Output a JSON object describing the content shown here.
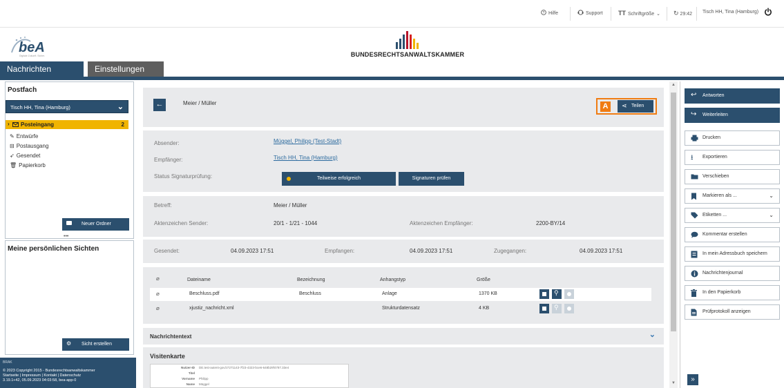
{
  "topbar": {
    "help": "Hilfe",
    "support": "Support",
    "font_size": "Schriftgröße",
    "timer": "29:42",
    "user": "Tisch HH, Tina (Hamburg)"
  },
  "logo_text": "beA",
  "logo_subtext": "Digitale Zukunft. Sicher.",
  "brand": "BUNDESRECHTSANWALTSKAMMER",
  "nav": {
    "messages": "Nachrichten",
    "settings": "Einstellungen"
  },
  "sidebar": {
    "title": "Postfach",
    "mailbox": "Tisch HH, Tina (Hamburg)",
    "folders": [
      {
        "label": "Posteingang",
        "count": "2"
      },
      {
        "label": "Entwürfe"
      },
      {
        "label": "Postausgang"
      },
      {
        "label": "Gesendet"
      },
      {
        "label": "Papierkorb"
      }
    ],
    "new_folder": "Neuer Ordner",
    "views_title": "Meine persönlichen Sichten",
    "create_view": "Sicht erstellen",
    "footer": [
      "© 2023 Copyright 2015 - Bundesrechtsanwaltskammer",
      "Startseite | Impressum | Kontakt | Datenschutz",
      "3.19.1+42, 05.09.2023 04:03:58, bea-app-0"
    ],
    "footer_logo": "BRAK"
  },
  "message": {
    "subject_header": "Meier / Müller",
    "share_badge": "A",
    "share": "Teilen",
    "sender_label": "Absender:",
    "sender": "Müggel, Philipp (Test-Stadt)",
    "recipient_label": "Empfänger:",
    "recipient": "Tisch HH, Tina (Hamburg)",
    "sig_label": "Status Signaturprüfung:",
    "sig_status": "Teilweise erfolgreich",
    "sig_check": "Signaturen prüfen",
    "subject_label": "Betreff:",
    "subject": "Meier / Müller",
    "ref_sender_label": "Aktenzeichen Sender:",
    "ref_sender": "20/1 - 1/21 - 1044",
    "ref_recipient_label": "Aktenzeichen Empfänger:",
    "ref_recipient": "2200-BY/14",
    "sent_label": "Gesendet:",
    "sent": "04.09.2023 17:51",
    "received_label": "Empfangen:",
    "received": "04.09.2023 17:51",
    "delivered_label": "Zugegangen:",
    "delivered": "04.09.2023 17:51"
  },
  "attachments": {
    "headers": [
      "Dateiname",
      "Bezeichnung",
      "Anhangstyp",
      "Größe"
    ],
    "rows": [
      {
        "name": "Beschluss.pdf",
        "label": "Beschluss",
        "type": "Anlage",
        "size": "1370 KB"
      },
      {
        "name": "xjustiz_nachricht.xml",
        "label": "",
        "type": "Strukturdatensatz",
        "size": "4 KB"
      }
    ]
  },
  "message_text": {
    "title": "Nachrichtentext"
  },
  "business_card": {
    "title": "Visitenkarte",
    "rows": [
      {
        "k": "Nutzer-ID",
        "v": "DE.test-autent-gov.b7271143-7f23-4323-bce6-648b29f4787.33e4"
      },
      {
        "k": "Titel",
        "v": ""
      },
      {
        "k": "Vorname",
        "v": "Philipp"
      },
      {
        "k": "Name",
        "v": "Müggel"
      }
    ]
  },
  "actions": [
    {
      "label": "Antworten",
      "icon": "reply-icon",
      "primary": true
    },
    {
      "label": "Weiterleiten",
      "icon": "forward-icon",
      "primary": true
    },
    {
      "label": "Drucken",
      "icon": "printer-icon"
    },
    {
      "label": "Exportieren",
      "icon": "download-icon"
    },
    {
      "label": "Verschieben",
      "icon": "folder-move-icon"
    },
    {
      "label": "Markieren als ...",
      "icon": "bookmark-icon",
      "dropdown": true
    },
    {
      "label": "Etiketten ...",
      "icon": "tags-icon",
      "dropdown": true
    },
    {
      "label": "Kommentar erstellen",
      "icon": "comment-icon"
    },
    {
      "label": "In mein Adressbuch speichern",
      "icon": "address-book-icon"
    },
    {
      "label": "Nachrichtenjournal",
      "icon": "info-icon"
    },
    {
      "label": "In den Papierkorb",
      "icon": "trash-icon"
    },
    {
      "label": "Prüfprotokoll anzeigen",
      "icon": "document-icon"
    }
  ],
  "expand_label": "»",
  "colors": {
    "brand_blue": "#2b4f6e",
    "accent_yellow": "#f0b400",
    "highlight_orange": "#f07c12",
    "link": "#2b6a9e"
  }
}
